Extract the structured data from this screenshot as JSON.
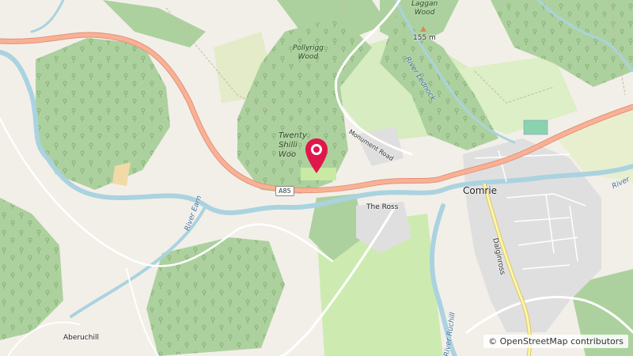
{
  "map": {
    "labels": {
      "laggan_wood": "Laggan\nWood",
      "peak": "155 m",
      "pollyrigg_wood": "Pollyrigg\nWood",
      "twenty_shilling_wood": "Twenty\nShilli\nWoo",
      "monument_road": "Monument Road",
      "river_lednock": "River Lednock",
      "a85": "A85",
      "comrie": "Comrie",
      "the_ross": "The Ross",
      "river_earn_west": "River Earn",
      "river_earn_east": "River",
      "dalginross": "Dalginross",
      "river_ruchill": "River Ruchill",
      "aberuchill": "Aberuchill"
    },
    "attribution": {
      "symbol": "©",
      "text": "OpenStreetMap contributors"
    },
    "colors": {
      "forest": "#add19e",
      "land": "#f2efe9",
      "water": "#aad3df",
      "primary_road": "#f8b195",
      "primary_road_casing": "#e2927a",
      "marker": "#e0174b",
      "grass": "#cdebb0"
    }
  }
}
